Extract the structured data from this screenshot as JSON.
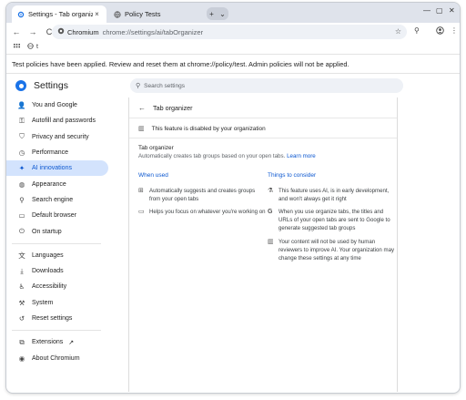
{
  "tabs": [
    {
      "label": "Settings - Tab organizer",
      "close": "×"
    },
    {
      "label": "Policy Tests"
    }
  ],
  "tabstrip": {
    "new_tab": "+",
    "tab_search": "⌄",
    "minimize": "—",
    "maximize": "▢",
    "close": "✕"
  },
  "toolbar": {
    "back": "←",
    "forward": "→",
    "reload": "C",
    "site": "Chromium",
    "url": "chrome://settings/ai/tabOrganizer",
    "star": "☆",
    "profile": "⬤",
    "menu": "⋮",
    "extension": "⚲"
  },
  "bookmarks": {
    "apps_icon": "apps-icon",
    "item": "t"
  },
  "infobar": {
    "text": "Test policies have been applied. Review and reset them at chrome://policy/test. Admin policies will not be applied."
  },
  "header": {
    "title": "Settings",
    "search_placeholder": "Search settings"
  },
  "sidebar": {
    "items": [
      {
        "label": "You and Google",
        "icon": "person-icon",
        "glyph": "👤"
      },
      {
        "label": "Autofill and passwords",
        "icon": "key-icon",
        "glyph": "⚿"
      },
      {
        "label": "Privacy and security",
        "icon": "shield-icon",
        "glyph": "⛉"
      },
      {
        "label": "Performance",
        "icon": "speed-icon",
        "glyph": "◷"
      },
      {
        "label": "AI innovations",
        "icon": "sparkle-icon",
        "glyph": "✦",
        "active": true
      },
      {
        "label": "Appearance",
        "icon": "palette-icon",
        "glyph": "◍"
      },
      {
        "label": "Search engine",
        "icon": "search-icon",
        "glyph": "⚲"
      },
      {
        "label": "Default browser",
        "icon": "browser-icon",
        "glyph": "▭"
      },
      {
        "label": "On startup",
        "icon": "power-icon",
        "glyph": "⏻"
      },
      {
        "label": "Languages",
        "icon": "translate-icon",
        "glyph": "文"
      },
      {
        "label": "Downloads",
        "icon": "download-icon",
        "glyph": "⤓"
      },
      {
        "label": "Accessibility",
        "icon": "accessibility-icon",
        "glyph": "♿"
      },
      {
        "label": "System",
        "icon": "wrench-icon",
        "glyph": "⚒"
      },
      {
        "label": "Reset settings",
        "icon": "reset-icon",
        "glyph": "↺"
      },
      {
        "label": "Extensions",
        "icon": "puzzle-icon",
        "glyph": "⧉"
      },
      {
        "label": "About Chromium",
        "icon": "info-icon",
        "glyph": "◉"
      }
    ],
    "extensions_external": "↗"
  },
  "page": {
    "title": "Tab organizer",
    "managed_notice": "This feature is disabled by your organization",
    "section_title": "Tab organizer",
    "section_desc": "Automatically creates tab groups based on your open tabs.",
    "learn_more": "Learn more",
    "when_used": {
      "heading": "When used",
      "items": [
        {
          "text": "Automatically suggests and creates groups from your open tabs"
        },
        {
          "text": "Helps you focus on whatever you're working on"
        }
      ]
    },
    "things": {
      "heading": "Things to consider",
      "items": [
        {
          "text": "This feature uses AI, is in early development, and won't always get it right"
        },
        {
          "text": "When you use organize tabs, the titles and URLs of your open tabs are sent to Google to generate suggested tab groups"
        },
        {
          "text": "Your content will not be used by human reviewers to improve AI. Your organization may change these settings at any time"
        }
      ]
    }
  },
  "colors": {
    "accent": "#0b57d0",
    "active_nav_bg": "#d3e3fd",
    "tabstrip_bg": "#dfe3eb",
    "omnibox_bg": "#eef1f6"
  }
}
